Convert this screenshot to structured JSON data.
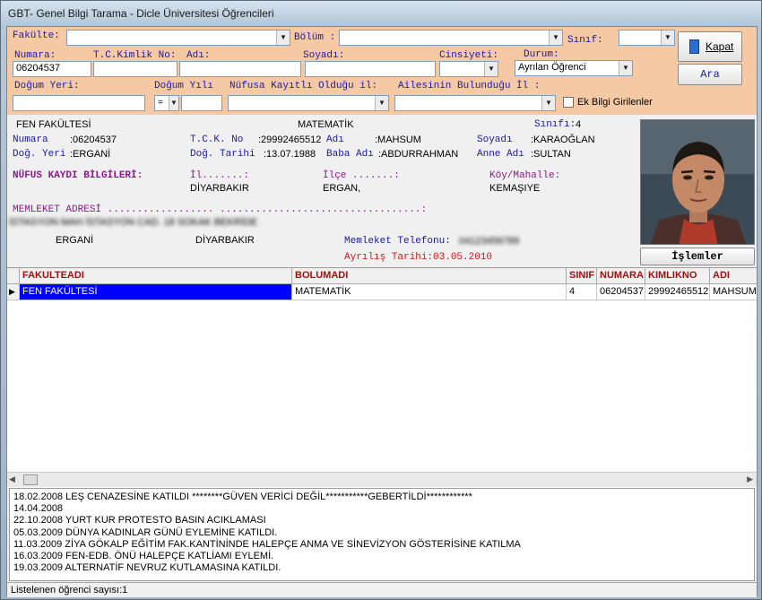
{
  "window": {
    "title": "GBT- Genel Bilgi Tarama - Dicle Üniversitesi Öğrencileri"
  },
  "filter": {
    "fakulte_label": "Fakülte:",
    "bolum_label": "Bölüm :",
    "sinif_label": "Sınıf:",
    "numara_label": "Numara:",
    "numara_value": "06204537",
    "tc_label": "T.C.Kimlik No:",
    "adi_label": "Adı:",
    "soyadi_label": "Soyadı:",
    "cinsiyeti_label": "Cinsiyeti:",
    "durum_label": "Durum:",
    "durum_value": "Ayrılan Öğrenci",
    "dogum_yeri_label": "Doğum Yeri:",
    "dogum_yili_label": "Doğum Yılı",
    "dogum_yili_op": "=",
    "nufus_label": "Nüfusa Kayıtlı Olduğu il:",
    "aile_label": "Ailesinin Bulunduğu İl :",
    "ek_bilgi_label": "Ek Bilgi Girilenler",
    "kapat_label": "Kapat",
    "ara_label": "Ara"
  },
  "detail": {
    "fakulte": "FEN FAKÜLTESİ",
    "bolum": "MATEMATİK",
    "sinif_label": "Sınıfı:",
    "sinif_value": "4",
    "numara_label": "Numara",
    "numara_value": ":06204537",
    "tck_label": "T.C.K. No",
    "tck_value": ":29992465512",
    "adi_label": "Adı",
    "adi_value": ":MAHSUM",
    "soyadi_label": "Soyadı",
    "soyadi_value": ":KARAOĞLAN",
    "dyeri_label": "Doğ. Yeri",
    "dyeri_value": ":ERGANİ",
    "dtarih_label": "Doğ. Tarihi",
    "dtarih_value": ":13.07.1988",
    "baba_label": "Baba Adı",
    "baba_value": ":ABDURRAHMAN",
    "anne_label": "Anne Adı",
    "anne_value": ":SULTAN",
    "nufus_label": "NÜFUS KAYDI BİLGİLERİ:",
    "il_label": "İl.......:",
    "il_value": "DİYARBAKIR",
    "ilce_label": "İlçe .......:",
    "ilce_value": "ERGAN,",
    "koy_label": "Köy/Mahalle:",
    "koy_value": "KEMAŞIYE",
    "memleket_label": "MEMLEKET ADRESİ  ..................  ..................................:",
    "adres_redacted": "İSTASYON MAH İSTASYON CAD. 18 SOKAK BEKRİDE",
    "adres_ilce": "ERGANİ",
    "adres_il": "DİYARBAKIR",
    "telefon_label": "Memleket Telefonu:",
    "telefon_redacted": "04123456789",
    "ayrilis": "Ayrılış Tarihi:03.05.2010",
    "islemler_label": "İşlemler"
  },
  "grid": {
    "columns": [
      "FAKULTEADI",
      "BOLUMADI",
      "SINIF",
      "NUMARA",
      "KIMLIKNO",
      "ADI"
    ],
    "row": [
      "FEN FAKÜLTESİ",
      "MATEMATİK",
      "4",
      "06204537",
      "29992465512",
      "MAHSUM"
    ],
    "selected_color": "#0000ff"
  },
  "log": {
    "lines": [
      "18.02.2008 LEŞ CENAZESİNE  KATILDI  ********GÜVEN VERİCİ DEĞİL***********GEBERTİLDİ************",
      "14.04.2008",
      "22.10.2008 YURT KUR PROTESTO BASIN ACIKLAMASI",
      "05.03.2009 DÜNYA KADINLAR GÜNÜ EYLEMİNE KATILDI.",
      "11.03.2009 ZİYA GÖKALP EĞİTİM FAK.KANTİNİNDE HALEPÇE ANMA VE SİNEVİZYON GÖSTERİSİNE KATILMA",
      "16.03.2009 FEN-EDB. ÖNÜ HALEPÇE KATLİAMI EYLEMİ.",
      "19.03.2009 ALTERNATİF NEVRUZ KUTLAMASINA KATILDI."
    ]
  },
  "status": {
    "text": "Listelenen öğrenci sayısı:1"
  },
  "colors": {
    "filter_bg": "#f5c9a4",
    "label_blue": "#1a1aa8",
    "label_purple": "#8a1a8a",
    "header_red": "#a01010"
  }
}
